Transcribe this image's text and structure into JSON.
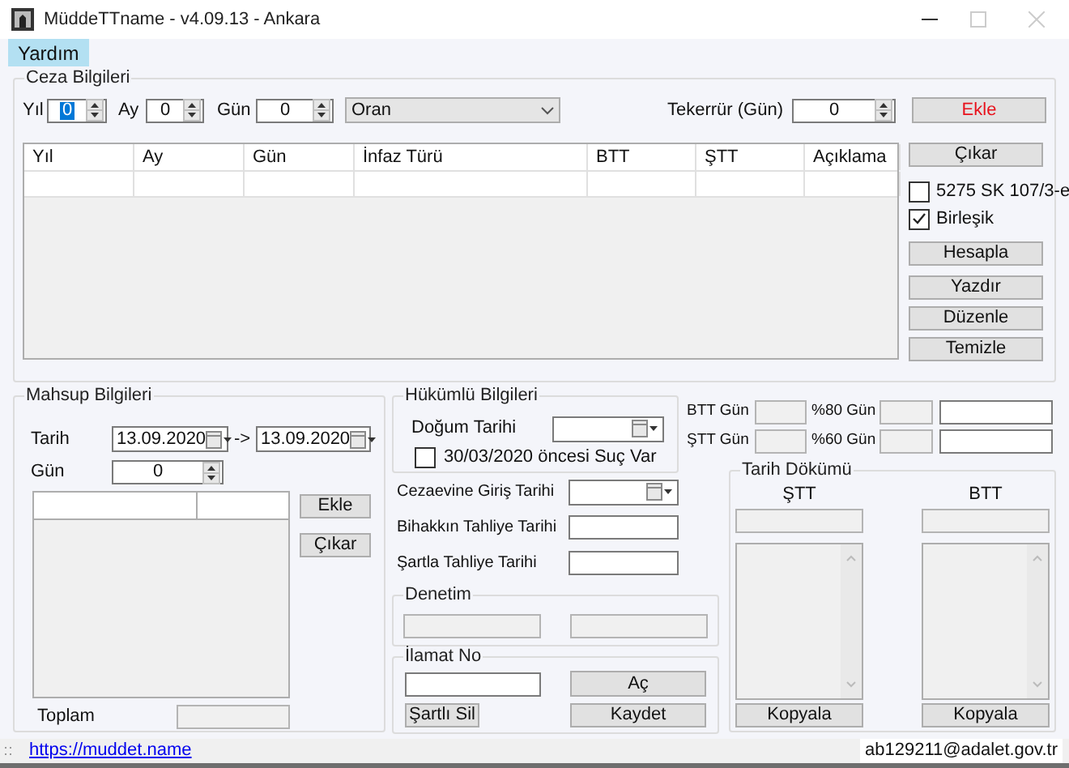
{
  "window": {
    "title": "MüddeTTname - v4.09.13 - Ankara"
  },
  "menu": [
    {
      "label": "Yardım",
      "selected": true
    }
  ],
  "ceza": {
    "title": "Ceza Bilgileri",
    "spins": [
      {
        "label": "Yıl",
        "value": "0",
        "focused": true
      },
      {
        "label": "Ay",
        "value": "0",
        "focused": false
      },
      {
        "label": "Gün",
        "value": "0",
        "focused": false
      }
    ],
    "combo": "Oran",
    "tekerrur": {
      "label": "Tekerrür (Gün)",
      "value": "0"
    },
    "add_button": {
      "label": "Ekle",
      "kind": "alert"
    },
    "columns": [
      "Yıl",
      "Ay",
      "Gün",
      "İnfaz Türü",
      "BTT",
      "ŞTT",
      "Açıklama"
    ],
    "side": [
      {
        "kind": "button",
        "label": "Çıkar"
      },
      {
        "kind": "checkbox",
        "label": "5275 SK 107/3-e",
        "checked": false
      },
      {
        "kind": "checkbox",
        "label": "Birleşik",
        "checked": true
      },
      {
        "kind": "button",
        "label": "Hesapla"
      },
      {
        "kind": "button",
        "label": "Yazdır"
      },
      {
        "kind": "button",
        "label": "Düzenle"
      },
      {
        "kind": "button",
        "label": "Temizle"
      }
    ]
  },
  "mahsup": {
    "title": "Mahsup Bilgileri",
    "date_label": "Tarih",
    "from": "13.09.2020",
    "arrow": "->",
    "to": "13.09.2020",
    "day_label": "Gün",
    "day_value": "0",
    "buttons": [
      "Ekle",
      "Çıkar"
    ],
    "total_label": "Toplam"
  },
  "hukumlu": {
    "title": "Hükümlü Bilgileri",
    "birth_label": "Doğum Tarihi",
    "option": {
      "label": "30/03/2020 öncesi Suç Var",
      "checked": false
    }
  },
  "gun_rows": [
    {
      "label": "BTT Gün",
      "pct_label": "%80 Gün"
    },
    {
      "label": "ŞTT Gün",
      "pct_label": "%60 Gün"
    }
  ],
  "dates": [
    {
      "label": "Cezaevine Giriş Tarihi",
      "kind": "date"
    },
    {
      "label": "Bihakkın Tahliye Tarihi",
      "kind": "text"
    },
    {
      "label": "Şartla Tahliye Tarihi",
      "kind": "text"
    }
  ],
  "denetim": {
    "title": "Denetim"
  },
  "ilamat": {
    "title": "İlamat No",
    "open": "Aç",
    "delete": "Şartlı Sil",
    "save": "Kaydet"
  },
  "tarih_dokumu": {
    "title": "Tarih Dökümü",
    "columns": [
      {
        "heading": "ŞTT",
        "button": "Kopyala"
      },
      {
        "heading": "BTT",
        "button": "Kopyala"
      }
    ]
  },
  "status_bar": {
    "link": "https://muddet.name",
    "user": "ab129211@adalet.gov.tr"
  }
}
